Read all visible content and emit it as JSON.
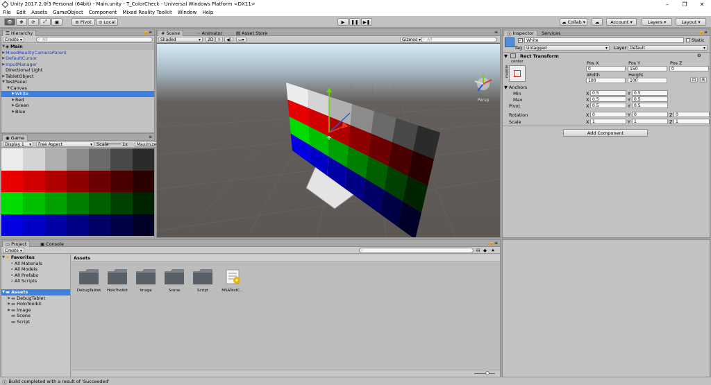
{
  "window": {
    "title": "Unity 2017.2.0f3 Personal (64bit) - Main.unity - T_ColorCheck - Universal Windows Platform <DX11>",
    "minimize": "–",
    "maximize": "❐",
    "close": "✕"
  },
  "menu": [
    "File",
    "Edit",
    "Assets",
    "GameObject",
    "Component",
    "Mixed Reality Toolkit",
    "Window",
    "Help"
  ],
  "toolbar": {
    "pivot": "Pivot",
    "local": "Local",
    "collab": "Collab ▾",
    "account": "Account",
    "layers": "Layers",
    "layout": "Layout"
  },
  "hierarchy": {
    "tab": "Hierarchy",
    "create": "Create ▾",
    "search_placeholder": "All",
    "scene": "Main",
    "items": [
      {
        "label": "MixedRealityCameraParent",
        "indent": 1,
        "arrow": "▶",
        "prefab": true
      },
      {
        "label": "DefaultCursor",
        "indent": 1,
        "arrow": "▶",
        "prefab": true
      },
      {
        "label": "InputManager",
        "indent": 1,
        "arrow": "▶",
        "prefab": true
      },
      {
        "label": "Directional Light",
        "indent": 1,
        "arrow": "",
        "prefab": false
      },
      {
        "label": "TabletObject",
        "indent": 1,
        "arrow": "▶",
        "prefab": false
      },
      {
        "label": "TestPanel",
        "indent": 1,
        "arrow": "▼",
        "prefab": false
      },
      {
        "label": "Canvas",
        "indent": 2,
        "arrow": "▼",
        "prefab": false
      },
      {
        "label": "White",
        "indent": 3,
        "arrow": "▶",
        "prefab": false,
        "selected": true
      },
      {
        "label": "Red",
        "indent": 3,
        "arrow": "▶",
        "prefab": false
      },
      {
        "label": "Green",
        "indent": 3,
        "arrow": "▶",
        "prefab": false
      },
      {
        "label": "Blue",
        "indent": 3,
        "arrow": "▶",
        "prefab": false
      }
    ]
  },
  "game": {
    "tab": "Game",
    "display": "Display 1",
    "aspect": "Free Aspect",
    "scale_label": "Scale",
    "scale_value": "1x",
    "maximize": "Maximize O",
    "rows": [
      [
        "#ececec",
        "#d4d4d4",
        "#b0b0b0",
        "#8b8b8b",
        "#6a6a6a",
        "#484848",
        "#2b2b2b"
      ],
      [
        "#e80000",
        "#d10000",
        "#b00000",
        "#8e0000",
        "#6d0000",
        "#4b0000",
        "#2b0000"
      ],
      [
        "#00dc00",
        "#00c000",
        "#00a000",
        "#007f00",
        "#006000",
        "#004000",
        "#002300"
      ],
      [
        "#0000e0",
        "#0000c6",
        "#0000a6",
        "#000086",
        "#000066",
        "#000046",
        "#000028"
      ]
    ]
  },
  "scene_view": {
    "tabs": [
      "Scene",
      "Animator",
      "Asset Store"
    ],
    "shaded": "Shaded",
    "mode2d": "2D",
    "gizmos": "Gizmos ▾",
    "search_placeholder": "All",
    "persp": "Persp"
  },
  "inspector": {
    "tabs": [
      "Inspector",
      "Services"
    ],
    "object_name": "White",
    "static": "Static",
    "tag_label": "Tag",
    "tag_value": "Untagged",
    "layer_label": "Layer",
    "layer_value": "Default",
    "component": "Rect Transform",
    "anchor_preset_top": "center",
    "anchor_preset_side": "middle",
    "posx_label": "Pos X",
    "posy_label": "Pos Y",
    "posz_label": "Pos Z",
    "posx": "0",
    "posy": "150",
    "posz": "0",
    "width_label": "Width",
    "height_label": "Height",
    "width": "100",
    "height": "100",
    "blueprint_btn": "⊡",
    "raw_btn": "R",
    "anchors_label": "Anchors",
    "min_label": "Min",
    "max_label": "Max",
    "pivot_label": "Pivot",
    "rotation_label": "Rotation",
    "scale_label": "Scale",
    "x": "X",
    "y": "Y",
    "z": "Z",
    "min_x": "0.5",
    "min_y": "0.5",
    "max_x": "0.5",
    "max_y": "0.5",
    "pivot_x": "0.5",
    "pivot_y": "0.5",
    "rot_x": "0",
    "rot_y": "0",
    "rot_z": "0",
    "scale_x": "1",
    "scale_y": "1",
    "scale_z": "1",
    "add_component": "Add Component"
  },
  "project": {
    "tabs": [
      "Project",
      "Console"
    ],
    "create": "Create ▾",
    "favorites": "Favorites",
    "fav_items": [
      "All Materials",
      "All Models",
      "All Prefabs",
      "All Scripts"
    ],
    "assets_root": "Assets",
    "asset_tree": [
      "DebugTablet",
      "HoloToolkit",
      "Image",
      "Scene",
      "Script"
    ],
    "breadcrumb": "Assets",
    "files": [
      "DebugTablet",
      "HoloToolkit",
      "Image",
      "Scene",
      "Script",
      "MSATestC..."
    ]
  },
  "status": {
    "message": "Build completed with a result of 'Succeeded'"
  }
}
